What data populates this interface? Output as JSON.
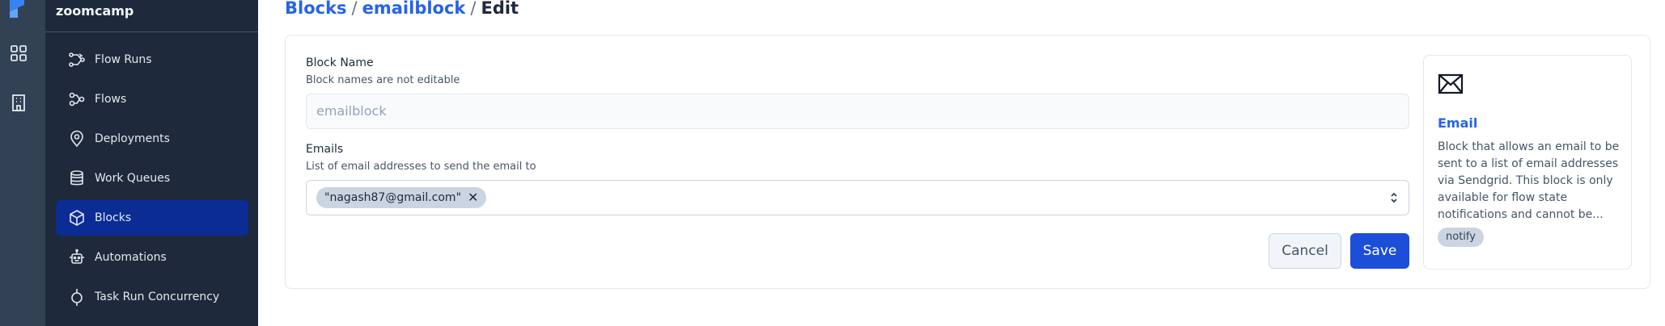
{
  "workspace": {
    "name": "zoomcamp"
  },
  "rail": {
    "icons": [
      "prefect-logo-icon",
      "dashboard-grid-icon",
      "building-icon"
    ]
  },
  "sidebar": {
    "items": [
      {
        "label": "Flow Runs",
        "icon": "flow-runs-icon",
        "active": false
      },
      {
        "label": "Flows",
        "icon": "flows-icon",
        "active": false
      },
      {
        "label": "Deployments",
        "icon": "map-pin-icon",
        "active": false
      },
      {
        "label": "Work Queues",
        "icon": "database-icon",
        "active": false
      },
      {
        "label": "Blocks",
        "icon": "cube-icon",
        "active": true
      },
      {
        "label": "Automations",
        "icon": "robot-icon",
        "active": false
      },
      {
        "label": "Task Run Concurrency",
        "icon": "concurrency-icon",
        "active": false
      }
    ]
  },
  "breadcrumb": {
    "root": "Blocks",
    "block": "emailblock",
    "current": "Edit",
    "separator": "/"
  },
  "form": {
    "block_name": {
      "label": "Block Name",
      "description": "Block names are not editable",
      "value": "emailblock"
    },
    "emails": {
      "label": "Emails",
      "description": "List of email addresses to send the email to",
      "chips": [
        "\"nagash87@gmail.com\""
      ]
    },
    "cancel_label": "Cancel",
    "save_label": "Save"
  },
  "block_type": {
    "icon": "envelope-icon",
    "name": "Email",
    "description": "Block that allows an email to be sent to a list of email addresses via Sendgrid. This block is only available for flow state notifications and cannot be...",
    "tag": "notify"
  },
  "colors": {
    "accent": "#2563eb",
    "primary_button": "#1d4ed8",
    "sidebar": "#1e293b",
    "rail": "#334155",
    "active_nav": "#0b2c94"
  }
}
